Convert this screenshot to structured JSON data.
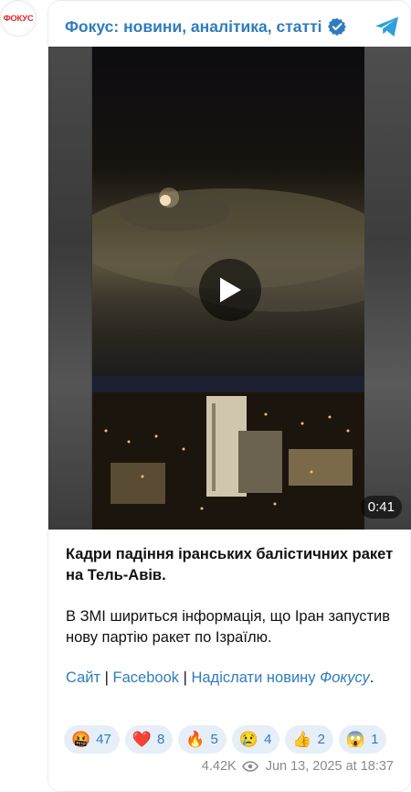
{
  "avatar": {
    "logo_text": "ФОКУС"
  },
  "channel": {
    "name": "Фокус: новини, аналітика, статті"
  },
  "video": {
    "duration": "0:41"
  },
  "post": {
    "headline": "Кадри падіння іранських балістичних ракет на Тель-Авів.",
    "body": "В ЗМІ шириться інформація, що Іран запустив нову партію ракет по Ізраїлю.",
    "links": {
      "site": "Сайт",
      "sep1": " | ",
      "facebook": "Facebook",
      "sep2": " | ",
      "submit": "Надіслати новину",
      "submit_tail": "Фокусу",
      "period": "."
    }
  },
  "reactions": [
    {
      "emoji": "🤬",
      "count": "47"
    },
    {
      "emoji": "❤️",
      "count": "8"
    },
    {
      "emoji": "🔥",
      "count": "5"
    },
    {
      "emoji": "😢",
      "count": "4"
    },
    {
      "emoji": "👍",
      "count": "2"
    },
    {
      "emoji": "😱",
      "count": "1"
    }
  ],
  "meta": {
    "views": "4.42K",
    "date": "Jun 13, 2025 at 18:37"
  },
  "colors": {
    "accent": "#2f7cbd",
    "reaction_bg": "#e6eff8",
    "logo_red": "#e3262c"
  }
}
